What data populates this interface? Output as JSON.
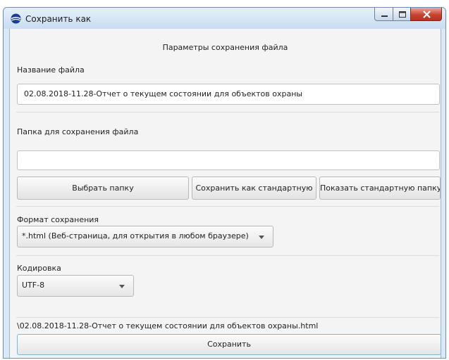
{
  "window": {
    "title": "Сохранить как"
  },
  "form": {
    "header": "Параметры сохранения файла",
    "filename_label": "Название файла",
    "filename_value": "02.08.2018-11.28-Отчет о текущем состоянии для объектов охраны",
    "folder_label": "Папка для сохранения файла",
    "folder_value": "",
    "choose_folder_button": "Выбрать папку",
    "save_as_default_button": "Сохранить как стандартную",
    "show_default_folder_button": "Показать стандартную папку",
    "format_label": "Формат сохранения",
    "format_selected": "*.html (Веб-страница, для открытия в любом браузере)",
    "encoding_label": "Кодировка",
    "encoding_selected": "UTF-8",
    "path_preview": "\\02.08.2018-11.28-Отчет о текущем состоянии для объектов охраны.html",
    "save_button": "Сохранить"
  },
  "colors": {
    "accent_border": "#7fb3dc",
    "close_button": "#c8432f"
  },
  "icons": [
    "app-icon",
    "minimize-icon",
    "maximize-icon",
    "close-icon",
    "chevron-down-icon"
  ]
}
